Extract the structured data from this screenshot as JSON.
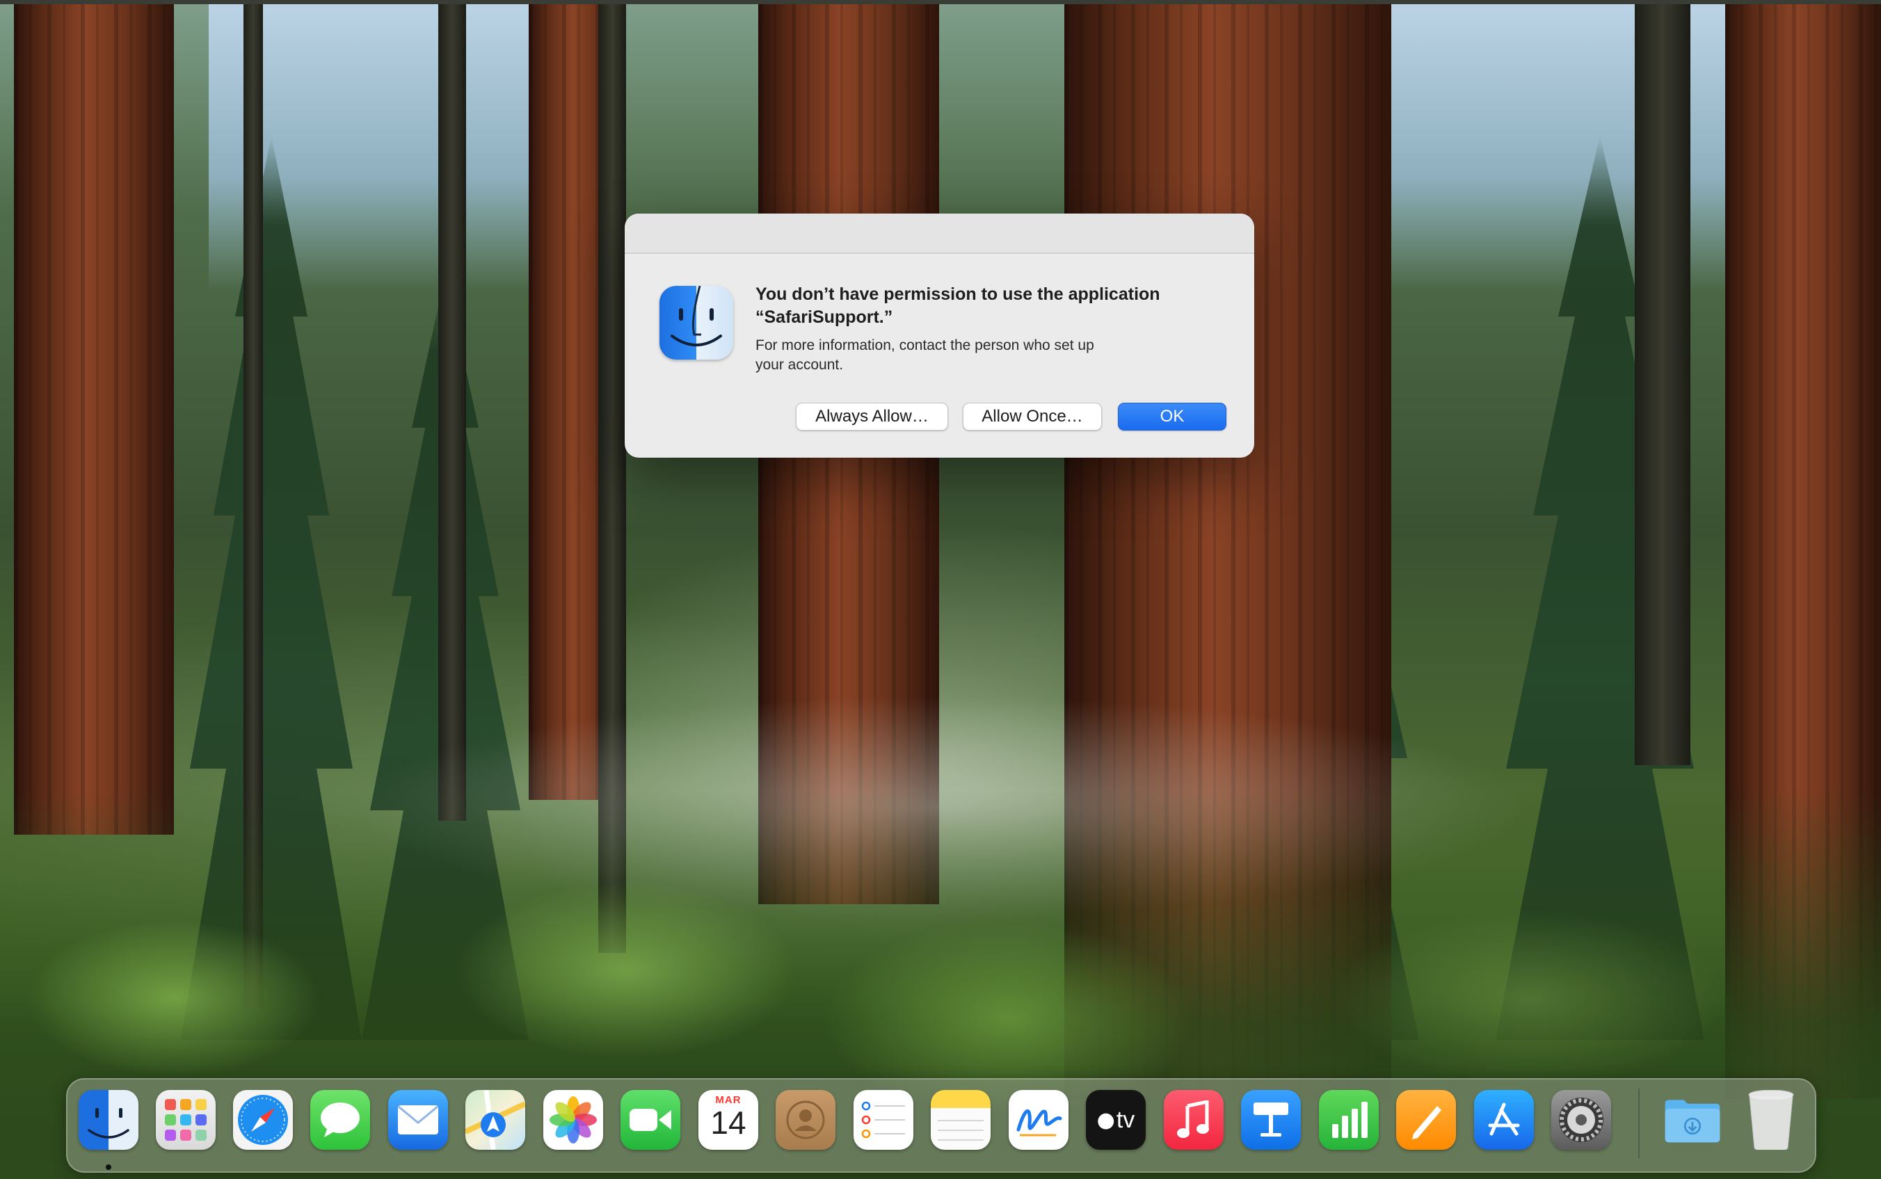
{
  "dialog": {
    "title": "You don’t have permission to use the application\n“SafariSupport.”",
    "message": "For more information, contact the person who set up\nyour account.",
    "buttons": {
      "always_allow": "Always Allow…",
      "allow_once": "Allow Once…",
      "ok": "OK"
    },
    "icon": "finder-icon"
  },
  "dock": {
    "calendar": {
      "month": "MAR",
      "day": "14"
    },
    "tv_label": "tv",
    "apps": [
      "Finder",
      "Launchpad",
      "Safari",
      "Messages",
      "Mail",
      "Maps",
      "Photos",
      "FaceTime",
      "Calendar",
      "Contacts",
      "Reminders",
      "Notes",
      "Freeform",
      "Apple TV",
      "Music",
      "Keynote",
      "Numbers",
      "Pages",
      "App Store",
      "System Settings",
      "Downloads",
      "Trash"
    ]
  },
  "colors": {
    "dialog_bg": "#ebebeb",
    "accent_blue": "#1a6cf0"
  }
}
